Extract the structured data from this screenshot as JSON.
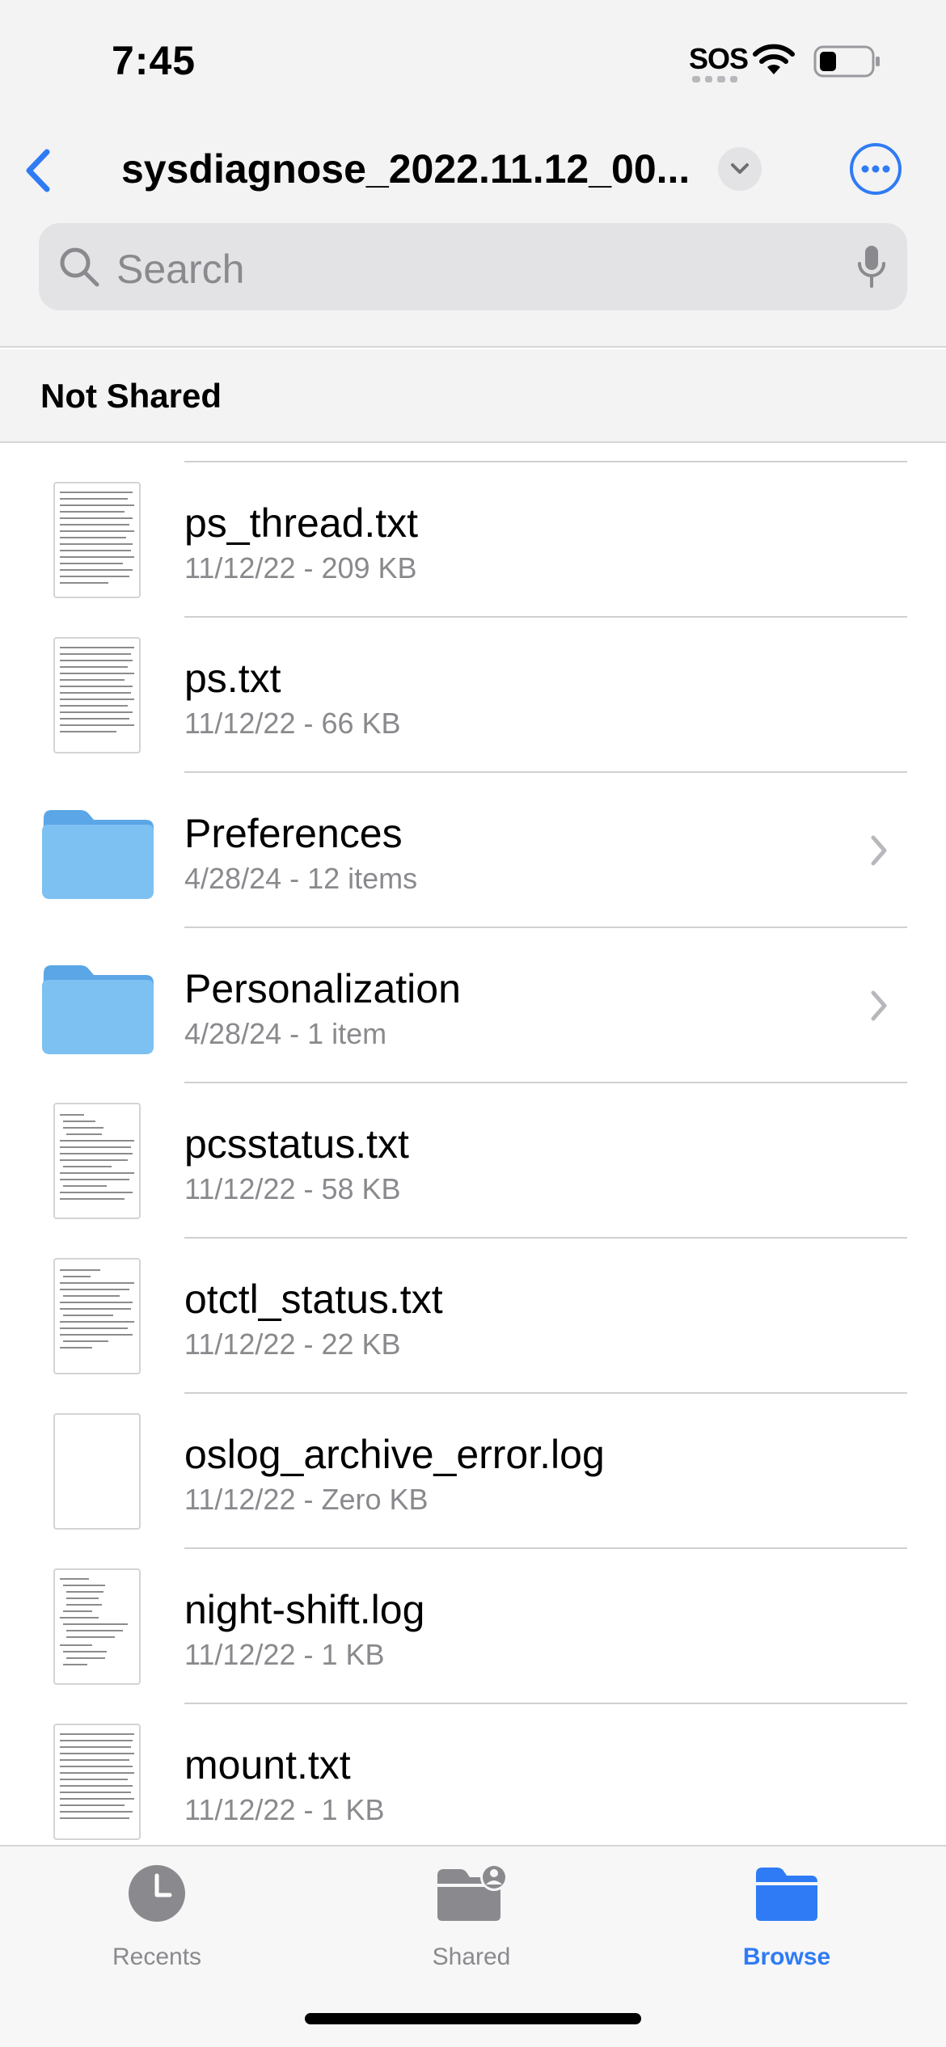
{
  "status_bar": {
    "time": "7:45",
    "sos": "SOS"
  },
  "nav": {
    "title": "sysdiagnose_2022.11.12_00..."
  },
  "search": {
    "placeholder": "Search"
  },
  "section": {
    "title": "Not Shared"
  },
  "items": [
    {
      "name": "ps_thread.txt",
      "meta": "11/12/22 - 209 KB",
      "kind": "file"
    },
    {
      "name": "ps.txt",
      "meta": "11/12/22 - 66 KB",
      "kind": "file"
    },
    {
      "name": "Preferences",
      "meta": "4/28/24 - 12 items",
      "kind": "folder"
    },
    {
      "name": "Personalization",
      "meta": "4/28/24 - 1 item",
      "kind": "folder"
    },
    {
      "name": "pcsstatus.txt",
      "meta": "11/12/22 - 58 KB",
      "kind": "file"
    },
    {
      "name": "otctl_status.txt",
      "meta": "11/12/22 - 22 KB",
      "kind": "file"
    },
    {
      "name": "oslog_archive_error.log",
      "meta": "11/12/22 - Zero KB",
      "kind": "file"
    },
    {
      "name": "night-shift.log",
      "meta": "11/12/22 - 1 KB",
      "kind": "file"
    },
    {
      "name": "mount.txt",
      "meta": "11/12/22 - 1 KB",
      "kind": "file"
    }
  ],
  "tabs": [
    {
      "label": "Recents",
      "icon": "clock-icon",
      "active": false
    },
    {
      "label": "Shared",
      "icon": "shared-folder-icon",
      "active": false
    },
    {
      "label": "Browse",
      "icon": "folder-icon",
      "active": true
    }
  ],
  "colors": {
    "accent": "#2f7bf5",
    "folder": "#6fb6ef",
    "secondary_text": "#8a8a8e"
  }
}
